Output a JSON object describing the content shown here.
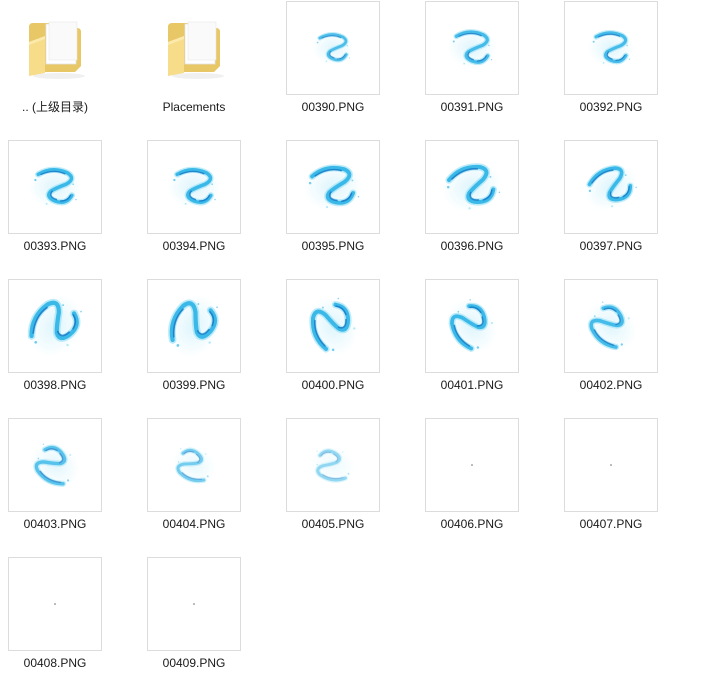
{
  "explorer": {
    "items": [
      {
        "label": ".. (上级目录)",
        "kind": "folder",
        "icon": "folder-icon",
        "thumb": "folder"
      },
      {
        "label": "Placements",
        "kind": "folder",
        "icon": "folder-icon",
        "thumb": "folder"
      },
      {
        "label": "00390.PNG",
        "kind": "image",
        "icon": "water-swirl-thumbnail",
        "thumb": "swirl",
        "rot": 0,
        "scale": 0.55,
        "op": 0.9
      },
      {
        "label": "00391.PNG",
        "kind": "image",
        "icon": "water-swirl-thumbnail",
        "thumb": "swirl",
        "rot": 0,
        "scale": 0.65,
        "op": 0.95
      },
      {
        "label": "00392.PNG",
        "kind": "image",
        "icon": "water-swirl-thumbnail",
        "thumb": "swirl",
        "rot": 0,
        "scale": 0.62,
        "op": 0.95
      },
      {
        "label": "00393.PNG",
        "kind": "image",
        "icon": "water-swirl-thumbnail",
        "thumb": "swirl",
        "rot": 0,
        "scale": 0.7,
        "op": 1
      },
      {
        "label": "00394.PNG",
        "kind": "image",
        "icon": "water-swirl-thumbnail",
        "thumb": "swirl",
        "rot": 0,
        "scale": 0.7,
        "op": 1
      },
      {
        "label": "00395.PNG",
        "kind": "image",
        "icon": "water-swirl-thumbnail",
        "thumb": "swirl",
        "rot": -10,
        "scale": 0.78,
        "op": 1
      },
      {
        "label": "00396.PNG",
        "kind": "image",
        "icon": "water-swirl-thumbnail",
        "thumb": "swirl",
        "rot": -20,
        "scale": 0.8,
        "op": 1
      },
      {
        "label": "00397.PNG",
        "kind": "image",
        "icon": "water-swirl-thumbnail",
        "thumb": "swirl",
        "rot": -30,
        "scale": 0.72,
        "op": 1
      },
      {
        "label": "00398.PNG",
        "kind": "image",
        "icon": "water-swirl-thumbnail",
        "thumb": "swirl",
        "rot": -60,
        "scale": 0.85,
        "op": 1
      },
      {
        "label": "00399.PNG",
        "kind": "image",
        "icon": "water-swirl-thumbnail",
        "thumb": "swirl",
        "rot": -70,
        "scale": 0.85,
        "op": 1
      },
      {
        "label": "00400.PNG",
        "kind": "image",
        "icon": "water-swirl-thumbnail",
        "thumb": "swirl",
        "rot": -110,
        "scale": 0.8,
        "op": 1
      },
      {
        "label": "00401.PNG",
        "kind": "image",
        "icon": "water-swirl-thumbnail",
        "thumb": "swirl",
        "rot": -125,
        "scale": 0.75,
        "op": 1
      },
      {
        "label": "00402.PNG",
        "kind": "image",
        "icon": "water-swirl-thumbnail",
        "thumb": "swirl",
        "rot": -140,
        "scale": 0.72,
        "op": 0.95
      },
      {
        "label": "00403.PNG",
        "kind": "image",
        "icon": "water-swirl-thumbnail",
        "thumb": "swirl",
        "rot": -150,
        "scale": 0.68,
        "op": 0.85
      },
      {
        "label": "00404.PNG",
        "kind": "image",
        "icon": "water-swirl-thumbnail",
        "thumb": "swirl",
        "rot": -160,
        "scale": 0.6,
        "op": 0.7
      },
      {
        "label": "00405.PNG",
        "kind": "image",
        "icon": "water-swirl-thumbnail",
        "thumb": "swirl",
        "rot": -170,
        "scale": 0.6,
        "op": 0.55
      },
      {
        "label": "00406.PNG",
        "kind": "image",
        "icon": "faint-dot-thumbnail",
        "thumb": "dot"
      },
      {
        "label": "00407.PNG",
        "kind": "image",
        "icon": "faint-dot-thumbnail",
        "thumb": "dot"
      },
      {
        "label": "00408.PNG",
        "kind": "image",
        "icon": "faint-dot-thumbnail",
        "thumb": "dot"
      },
      {
        "label": "00409.PNG",
        "kind": "image",
        "icon": "faint-dot-thumbnail",
        "thumb": "dot"
      }
    ],
    "colors": {
      "folder_back": "#e8c766",
      "folder_front": "#f7dc8a",
      "folder_paper": "#ffffff",
      "water_light": "#9fe3f7",
      "water_mid": "#3ab8e8",
      "water_dark": "#1477c4",
      "thumb_border": "#dcdcdc",
      "label_text": "#1a1a1a"
    }
  }
}
